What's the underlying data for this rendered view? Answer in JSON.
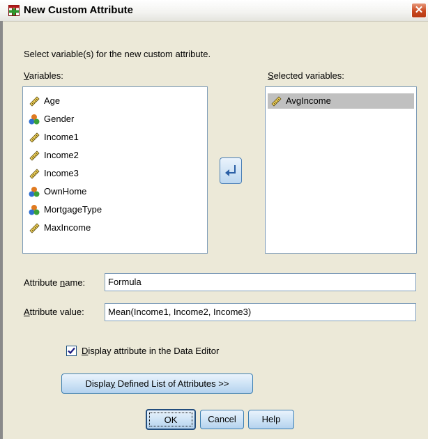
{
  "window": {
    "title": "New Custom Attribute"
  },
  "instructions": "Select variable(s) for the new custom attribute.",
  "variables_list": {
    "label_ul": "V",
    "label_rest": "ariables:",
    "items": [
      {
        "label": "Age",
        "icon": "scale-ruler-icon"
      },
      {
        "label": "Gender",
        "icon": "nominal-balls-icon"
      },
      {
        "label": "Income1",
        "icon": "scale-ruler-icon"
      },
      {
        "label": "Income2",
        "icon": "scale-ruler-icon"
      },
      {
        "label": "Income3",
        "icon": "scale-ruler-icon"
      },
      {
        "label": "OwnHome",
        "icon": "nominal-balls-icon"
      },
      {
        "label": "MortgageType",
        "icon": "nominal-balls-icon"
      },
      {
        "label": "MaxIncome",
        "icon": "scale-ruler-icon"
      }
    ]
  },
  "selected_list": {
    "label_ul": "S",
    "label_rest": "elected variables:",
    "items": [
      {
        "label": "AvgIncome",
        "icon": "scale-ruler-icon",
        "selected": true
      }
    ]
  },
  "attribute_name": {
    "label_pre": "Attribute ",
    "label_ul": "n",
    "label_post": "ame:",
    "value": "Formula"
  },
  "attribute_value": {
    "label_ul": "A",
    "label_rest": "ttribute value:",
    "value": "Mean(Income1, Income2, Income3)"
  },
  "display_checkbox": {
    "label_ul": "D",
    "label_rest": "isplay attribute in the Data Editor",
    "checked": true
  },
  "buttons": {
    "display_list": {
      "label_pre": "Displa",
      "label_ul": "y",
      "label_post": " Defined List of Attributes >>"
    },
    "ok": "OK",
    "cancel": "Cancel",
    "help": "Help"
  },
  "colors": {
    "selection": "#c0c0c0",
    "button_border": "#3c7fb1",
    "close": "#c9481f"
  }
}
